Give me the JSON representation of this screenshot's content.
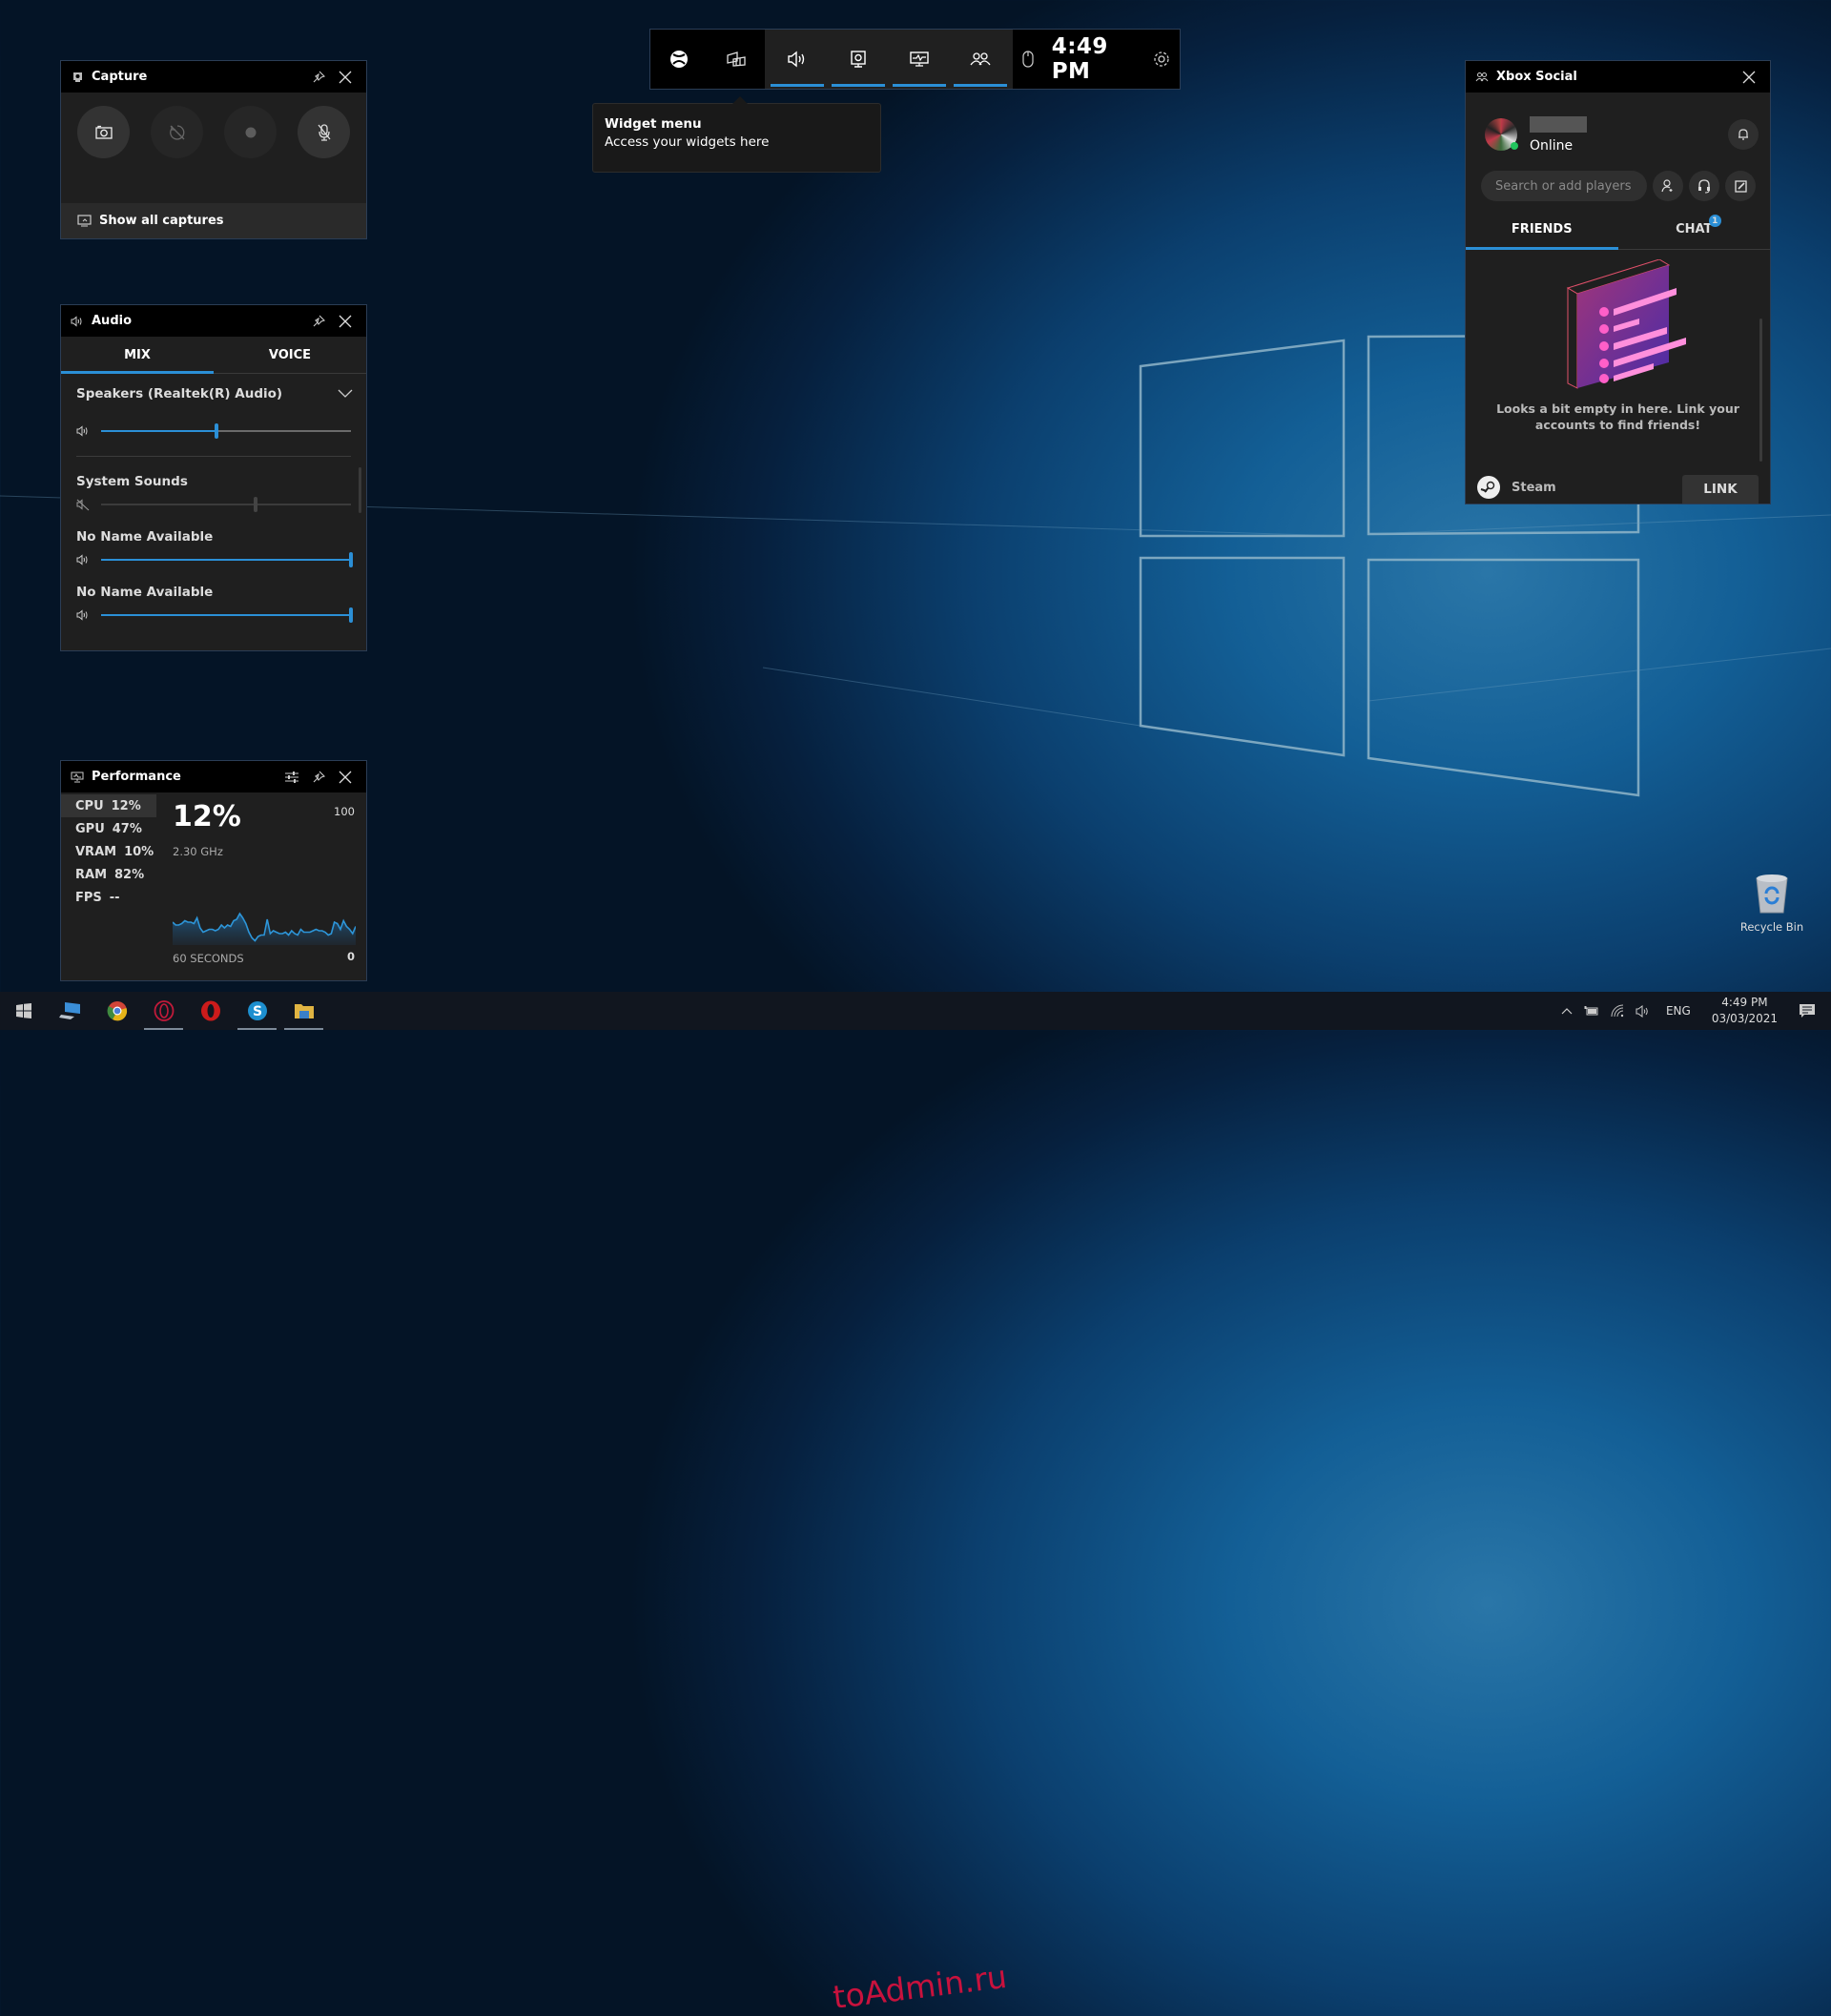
{
  "topbar": {
    "buttons": [
      {
        "name": "xbox-icon",
        "label": "Xbox"
      },
      {
        "name": "widget-menu-icon",
        "label": "Widget menu"
      },
      {
        "name": "audio-icon",
        "label": "Audio"
      },
      {
        "name": "capture-icon",
        "label": "Capture"
      },
      {
        "name": "performance-icon",
        "label": "Performance"
      },
      {
        "name": "xbox-social-icon",
        "label": "Xbox Social"
      },
      {
        "name": "mouse-icon",
        "label": "Mouse"
      },
      {
        "name": "settings-icon",
        "label": "Settings"
      }
    ],
    "clock": "4:49 PM"
  },
  "tooltip": {
    "title": "Widget menu",
    "text": "Access your widgets here"
  },
  "capture": {
    "title": "Capture",
    "buttons": [
      "Take screenshot",
      "Record last 30 sec",
      "Start recording",
      "Turn mic on while recording"
    ],
    "show_all": "Show all captures"
  },
  "audio": {
    "title": "Audio",
    "tabs": [
      "MIX",
      "VOICE"
    ],
    "active_tab": "MIX",
    "device": "Speakers (Realtek(R) Audio)",
    "device_volume": 0.46,
    "apps": [
      {
        "name": "System Sounds",
        "volume": 0.62,
        "muted": true
      },
      {
        "name": "No Name Available",
        "volume": 1.0,
        "muted": false
      },
      {
        "name": "No Name Available",
        "volume": 1.0,
        "muted": false
      }
    ]
  },
  "performance": {
    "title": "Performance",
    "metrics": [
      {
        "label": "CPU",
        "value": "12%"
      },
      {
        "label": "GPU",
        "value": "47%"
      },
      {
        "label": "VRAM",
        "value": "10%"
      },
      {
        "label": "RAM",
        "value": "82%"
      },
      {
        "label": "FPS",
        "value": "--"
      }
    ],
    "selected": "CPU",
    "big_value": "12%",
    "frequency": "2.30 GHz",
    "axis_max": "100",
    "axis_min": "0",
    "window": "60 SECONDS",
    "history": [
      16,
      14,
      14,
      15,
      17,
      16,
      16,
      15,
      19,
      12,
      9,
      10,
      11,
      11,
      10,
      11,
      14,
      12,
      14,
      13,
      17,
      18,
      22,
      19,
      15,
      9,
      5,
      3,
      6,
      7,
      7,
      18,
      8,
      10,
      9,
      8,
      8,
      9,
      7,
      10,
      8,
      7,
      11,
      9,
      9,
      9,
      10,
      11,
      10,
      10,
      9,
      7,
      8,
      16,
      15,
      11,
      17,
      13,
      11,
      8,
      13
    ]
  },
  "social": {
    "title": "Xbox Social",
    "status": "Online",
    "search_placeholder": "Search or add players",
    "tabs": [
      "FRIENDS",
      "CHAT"
    ],
    "active_tab": "FRIENDS",
    "chat_badge": "1",
    "empty_message": "Looks a bit empty in here. Link your accounts to find friends!",
    "link_service": "Steam",
    "link_button": "LINK"
  },
  "desktop": {
    "recycle_bin": "Recycle Bin",
    "watermark": "toAdmin.ru"
  },
  "taskbar": {
    "apps": [
      "Start",
      "This PC",
      "Google Chrome",
      "Opera GX",
      "Opera",
      "Skype",
      "File Explorer"
    ],
    "language": "ENG",
    "time": "4:49 PM",
    "date": "03/03/2021"
  }
}
